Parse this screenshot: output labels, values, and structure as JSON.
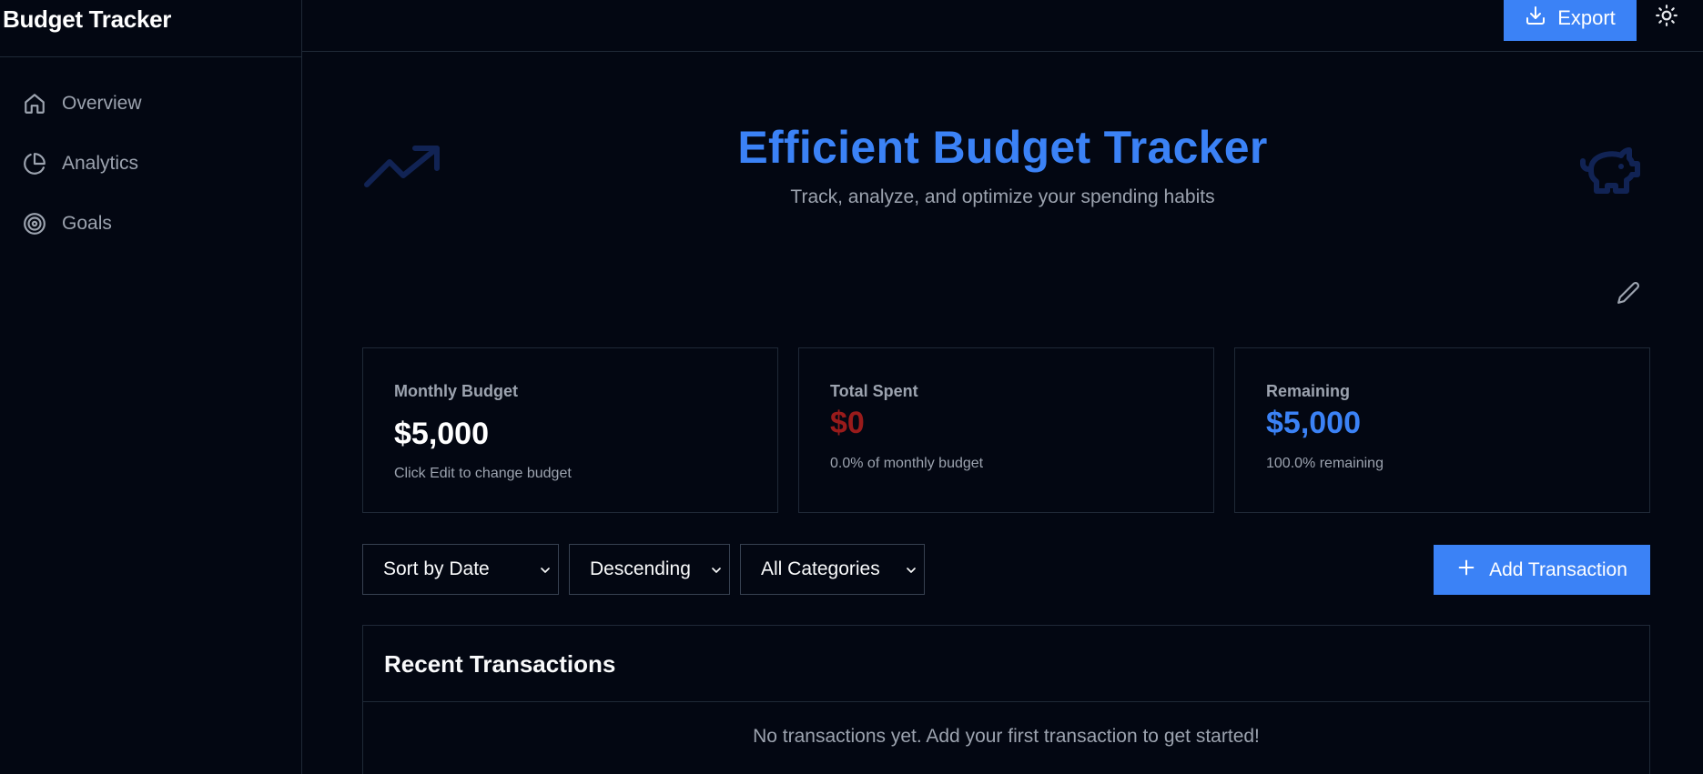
{
  "sidebar": {
    "brand": "Budget Tracker",
    "items": [
      {
        "label": "Overview",
        "icon": "home-icon"
      },
      {
        "label": "Analytics",
        "icon": "pie-chart-icon"
      },
      {
        "label": "Goals",
        "icon": "target-icon"
      }
    ]
  },
  "topbar": {
    "export_label": "Export",
    "theme_icon": "sun-icon"
  },
  "hero": {
    "title": "Efficient Budget Tracker",
    "subtitle": "Track, analyze, and optimize your spending habits"
  },
  "cards": {
    "budget": {
      "label": "Monthly Budget",
      "value": "$5,000",
      "note": "Click Edit to change budget",
      "color": "#ffffff"
    },
    "spent": {
      "label": "Total Spent",
      "value": "$0",
      "note": "0.0% of monthly budget",
      "color": "#991b1b"
    },
    "remaining": {
      "label": "Remaining",
      "value": "$5,000",
      "note": "100.0% remaining",
      "color": "#3b82f6"
    }
  },
  "controls": {
    "sort_by": "Sort by Date",
    "order": "Descending",
    "category": "All Categories",
    "add_label": "Add Transaction"
  },
  "transactions": {
    "title": "Recent Transactions",
    "empty": "No transactions yet. Add your first transaction to get started!"
  },
  "colors": {
    "accent": "#3b82f6",
    "background": "#030712",
    "border": "#1f2937"
  }
}
